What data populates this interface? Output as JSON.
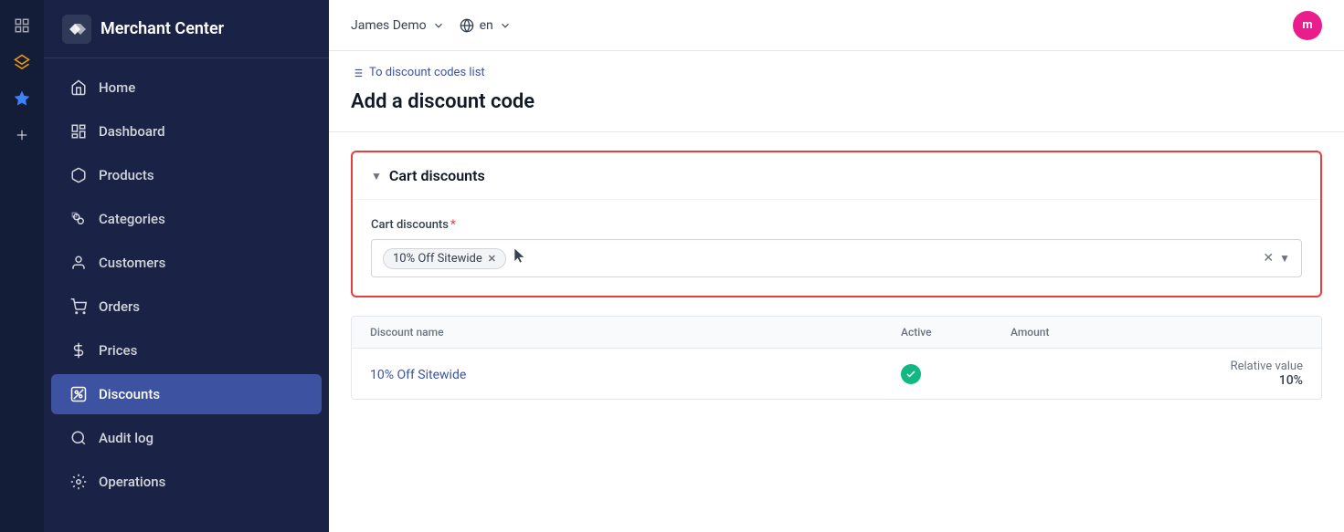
{
  "sidebar": {
    "title": "Merchant Center",
    "items": [
      {
        "id": "home",
        "label": "Home",
        "icon": "home",
        "active": false
      },
      {
        "id": "dashboard",
        "label": "Dashboard",
        "icon": "dashboard",
        "active": false
      },
      {
        "id": "products",
        "label": "Products",
        "icon": "products",
        "active": false
      },
      {
        "id": "categories",
        "label": "Categories",
        "icon": "categories",
        "active": false
      },
      {
        "id": "customers",
        "label": "Customers",
        "icon": "customers",
        "active": false
      },
      {
        "id": "orders",
        "label": "Orders",
        "icon": "orders",
        "active": false
      },
      {
        "id": "prices",
        "label": "Prices",
        "icon": "prices",
        "active": false
      },
      {
        "id": "discounts",
        "label": "Discounts",
        "icon": "discounts",
        "active": true
      },
      {
        "id": "audit-log",
        "label": "Audit log",
        "icon": "audit",
        "active": false
      },
      {
        "id": "operations",
        "label": "Operations",
        "icon": "operations",
        "active": false
      }
    ]
  },
  "topbar": {
    "store_name": "James Demo",
    "language": "en",
    "avatar_initials": "m"
  },
  "breadcrumb": {
    "label": "To discount codes list"
  },
  "page": {
    "title": "Add a discount code"
  },
  "cart_discounts_section": {
    "heading": "Cart discounts",
    "field_label": "Cart discounts",
    "required": true,
    "selected_tag": "10% Off Sitewide"
  },
  "table": {
    "columns": [
      "Discount name",
      "Active",
      "Amount",
      ""
    ],
    "rows": [
      {
        "name": "10% Off Sitewide",
        "active": true,
        "amount": "",
        "relative_value_label": "Relative value",
        "relative_value": "10%"
      }
    ]
  }
}
